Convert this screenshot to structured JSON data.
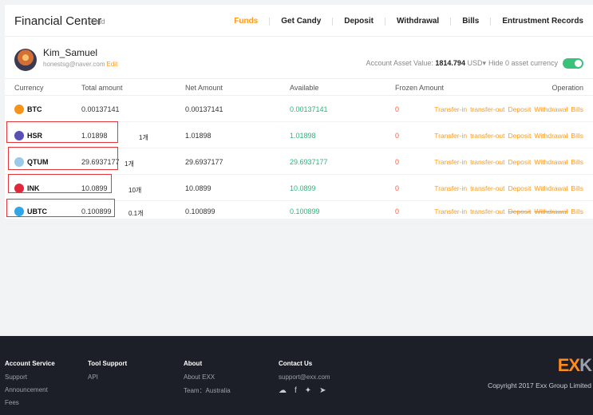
{
  "header": {
    "title": "Financial Center",
    "crumb": "/ Fund",
    "nav": [
      {
        "label": "Funds",
        "active": true
      },
      {
        "label": "Get Candy"
      },
      {
        "label": "Deposit"
      },
      {
        "label": "Withdrawal"
      },
      {
        "label": "Bills"
      },
      {
        "label": "Entrustment Records"
      }
    ]
  },
  "user": {
    "name": "Kim_Samuel",
    "email": "honestsg@naver.com",
    "edit": "Edit",
    "asset_label": "Account Asset Value:",
    "asset_value": "1814.794",
    "asset_unit": "USD▾",
    "hide_zero": "Hide 0 asset currency"
  },
  "table": {
    "headers": [
      "Currency",
      "Total amount",
      "Net Amount",
      "Available",
      "Frozen Amount",
      "Operation"
    ],
    "rows": [
      {
        "currency": "BTC",
        "coin_color": "#f7931a",
        "total": "0.00137141",
        "note": "",
        "net": "0.00137141",
        "available": "0.00137141",
        "frozen": "0"
      },
      {
        "currency": "HSR",
        "coin_color": "#5a4fb3",
        "total": "1.01898",
        "note": "1개",
        "net": "1.01898",
        "available": "1.01898",
        "frozen": "0"
      },
      {
        "currency": "QTUM",
        "coin_color": "#9cc9e8",
        "total": "29.6937177",
        "note": "1개",
        "net": "29.6937177",
        "available": "29.6937177",
        "frozen": "0"
      },
      {
        "currency": "INK",
        "coin_color": "#e0283b",
        "total": "10.0899",
        "note": "10개",
        "net": "10.0899",
        "available": "10.0899",
        "frozen": "0"
      },
      {
        "currency": "UBTC",
        "coin_color": "#2fa6e6",
        "total": "0.100899",
        "note": "0.1개",
        "net": "0.100899",
        "available": "0.100899",
        "frozen": "0"
      }
    ],
    "ops": [
      "Transfer-in",
      "transfer-out",
      "Deposit",
      "Withdrawal",
      "Bills"
    ]
  },
  "footer": {
    "cols": [
      {
        "title": "Account Service",
        "links": [
          "Support",
          "Announcement",
          "Fees"
        ]
      },
      {
        "title": "Tool Support",
        "links": [
          "API"
        ]
      },
      {
        "title": "About",
        "links": [
          "About EXX",
          "Team：Australia"
        ]
      },
      {
        "title": "Contact Us",
        "links": [
          "support@exx.com"
        ]
      }
    ],
    "logo_e": "EX",
    "logo_k": "K",
    "copyright": "Copyright 2017 Exx Group Limited"
  }
}
